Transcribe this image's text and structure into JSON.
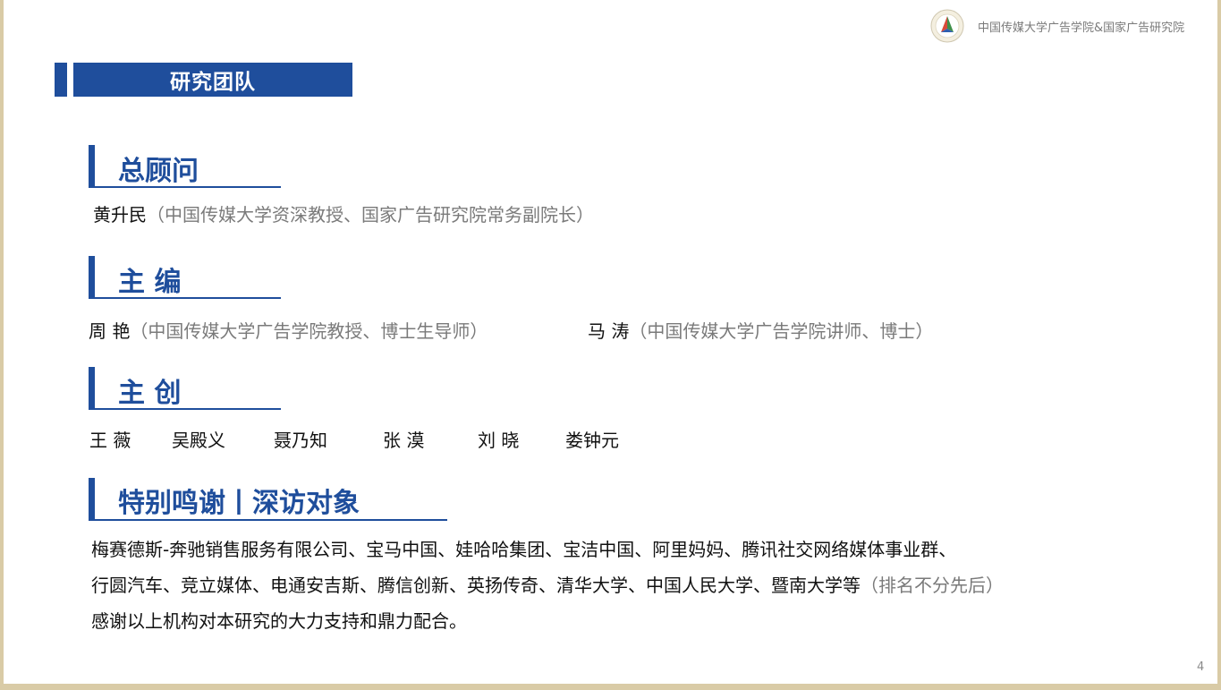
{
  "header": {
    "org_name": "中国传媒大学广告学院&国家广告研究院",
    "logo_icon": "triangle-seal-logo"
  },
  "title": "研究团队",
  "sections": {
    "advisor": {
      "heading": "总顾问",
      "name": "黄升民",
      "note": "（中国传媒大学资深教授、国家广告研究院常务副院长）"
    },
    "editors": {
      "heading": "主 编",
      "people": [
        {
          "name": "周 艳",
          "note": "（中国传媒大学广告学院教授、博士生导师）"
        },
        {
          "name": "马 涛",
          "note": "（中国传媒大学广告学院讲师、博士）"
        }
      ]
    },
    "creators": {
      "heading": "主 创",
      "names": [
        "王 薇",
        "吴殿义",
        "聂乃知",
        "张 漠",
        "刘 晓",
        "娄钟元"
      ]
    },
    "thanks": {
      "heading": "特别鸣谢丨深访对象",
      "line1": "梅赛德斯-奔驰销售服务有限公司、宝马中国、娃哈哈集团、宝洁中国、阿里妈妈、腾讯社交网络媒体事业群、",
      "line2": "行圆汽车、竞立媒体、电通安吉斯、腾信创新、英扬传奇、清华大学、中国人民大学、暨南大学等",
      "line2_note": "（排名不分先后）",
      "line3": "感谢以上机构对本研究的大力支持和鼎力配合。"
    }
  },
  "page_number": "4",
  "colors": {
    "accent": "#1f4e9c",
    "frame": "#d9cba6",
    "note_gray": "#7a7a7a"
  }
}
